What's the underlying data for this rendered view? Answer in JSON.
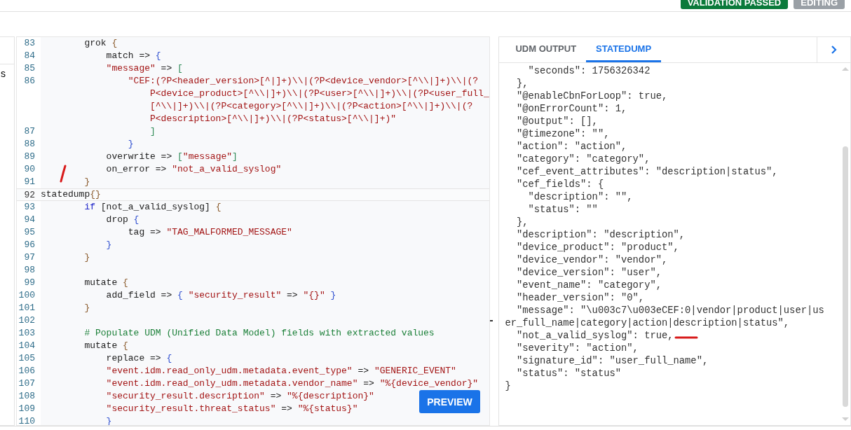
{
  "header": {
    "badges": [
      {
        "label": "VALIDATION PASSED",
        "kind": "success"
      },
      {
        "label": "EDITING",
        "kind": "neutral"
      }
    ]
  },
  "sidebar": {
    "text": "s"
  },
  "editor": {
    "rows": [
      {
        "number": "83",
        "current": false,
        "tokens": [
          {
            "kind": "plain",
            "text": "        grok "
          },
          {
            "kind": "brace1",
            "text": "{"
          }
        ]
      },
      {
        "number": "84",
        "current": false,
        "tokens": [
          {
            "kind": "plain",
            "text": "            match => "
          },
          {
            "kind": "brace2",
            "text": "{"
          }
        ]
      },
      {
        "number": "85",
        "current": false,
        "tokens": [
          {
            "kind": "string",
            "text": "            \"message\""
          },
          {
            "kind": "plain",
            "text": " => "
          },
          {
            "kind": "brace3",
            "text": "["
          }
        ]
      },
      {
        "number": "86",
        "current": false,
        "tokens": [
          {
            "kind": "string",
            "text": "                \"CEF:(?P<header_version>[^|]+)\\\\|(?P<device_vendor>[^\\\\|]+)\\\\|(?"
          }
        ]
      },
      {
        "current": false,
        "tokens": [
          {
            "kind": "string",
            "text": "                    P<device_product>[^\\\\|]+)\\\\|(?P<user>[^\\\\|]+)\\\\|(?P<user_full_"
          }
        ]
      },
      {
        "current": false,
        "tokens": [
          {
            "kind": "string",
            "text": "                    [^\\\\|]+)\\\\|(?P<category>[^\\\\|]+)\\\\|(?P<action>[^\\\\|]+)\\\\|(?"
          }
        ]
      },
      {
        "current": false,
        "tokens": [
          {
            "kind": "string",
            "text": "                    P<description>[^\\\\|]+)\\\\|(?P<status>[^\\\\|]+)\""
          }
        ]
      },
      {
        "number": "87",
        "current": false,
        "tokens": [
          {
            "kind": "brace3",
            "text": "                    ]"
          }
        ]
      },
      {
        "number": "88",
        "current": false,
        "tokens": [
          {
            "kind": "brace2",
            "text": "                }"
          }
        ]
      },
      {
        "number": "89",
        "current": false,
        "tokens": [
          {
            "kind": "plain",
            "text": "            overwrite => "
          },
          {
            "kind": "brace3",
            "text": "["
          },
          {
            "kind": "string",
            "text": "\"message\""
          },
          {
            "kind": "brace3",
            "text": "]"
          }
        ]
      },
      {
        "number": "90",
        "current": false,
        "tokens": [
          {
            "kind": "plain",
            "text": "            on_error => "
          },
          {
            "kind": "string",
            "text": "\"not_a_valid_syslog\""
          }
        ]
      },
      {
        "number": "91",
        "current": false,
        "tokens": [
          {
            "kind": "brace1",
            "text": "        }"
          }
        ]
      },
      {
        "number": "92",
        "current": true,
        "tokens": [
          {
            "kind": "plain",
            "text": "statedump"
          },
          {
            "kind": "brace1",
            "text": "{}"
          }
        ]
      },
      {
        "number": "93",
        "current": false,
        "tokens": [
          {
            "kind": "keyword",
            "text": "        if"
          },
          {
            "kind": "plain",
            "text": " [not_a_valid_syslog] "
          },
          {
            "kind": "brace1",
            "text": "{"
          }
        ]
      },
      {
        "number": "94",
        "current": false,
        "tokens": [
          {
            "kind": "plain",
            "text": "            drop "
          },
          {
            "kind": "brace2",
            "text": "{"
          }
        ]
      },
      {
        "number": "95",
        "current": false,
        "tokens": [
          {
            "kind": "plain",
            "text": "                tag => "
          },
          {
            "kind": "string",
            "text": "\"TAG_MALFORMED_MESSAGE\""
          }
        ]
      },
      {
        "number": "96",
        "current": false,
        "tokens": [
          {
            "kind": "brace2",
            "text": "            }"
          }
        ]
      },
      {
        "number": "97",
        "current": false,
        "tokens": [
          {
            "kind": "brace1",
            "text": "        }"
          }
        ]
      },
      {
        "number": "98",
        "current": false
      },
      {
        "number": "99",
        "current": false,
        "tokens": [
          {
            "kind": "plain",
            "text": "        mutate "
          },
          {
            "kind": "brace1",
            "text": "{"
          }
        ]
      },
      {
        "number": "100",
        "current": false,
        "tokens": [
          {
            "kind": "plain",
            "text": "            add_field => "
          },
          {
            "kind": "brace2",
            "text": "{"
          },
          {
            "kind": "string",
            "text": " \"security_result\""
          },
          {
            "kind": "plain",
            "text": " => "
          },
          {
            "kind": "string",
            "text": "\"{}\""
          },
          {
            "kind": "brace2",
            "text": " }"
          }
        ]
      },
      {
        "number": "101",
        "current": false,
        "tokens": [
          {
            "kind": "brace1",
            "text": "        }"
          }
        ]
      },
      {
        "number": "102",
        "current": false
      },
      {
        "number": "103",
        "current": false,
        "tokens": [
          {
            "kind": "comment",
            "text": "        # Populate UDM (Unified Data Model) fields with extracted values"
          }
        ]
      },
      {
        "number": "104",
        "current": false,
        "tokens": [
          {
            "kind": "plain",
            "text": "        mutate "
          },
          {
            "kind": "brace1",
            "text": "{"
          }
        ]
      },
      {
        "number": "105",
        "current": false,
        "tokens": [
          {
            "kind": "plain",
            "text": "            replace => "
          },
          {
            "kind": "brace2",
            "text": "{"
          }
        ]
      },
      {
        "number": "106",
        "current": false,
        "tokens": [
          {
            "kind": "string",
            "text": "            \"event.idm.read_only_udm.metadata.event_type\""
          },
          {
            "kind": "plain",
            "text": " => "
          },
          {
            "kind": "string",
            "text": "\"GENERIC_EVENT\""
          }
        ]
      },
      {
        "number": "107",
        "current": false,
        "tokens": [
          {
            "kind": "string",
            "text": "            \"event.idm.read_only_udm.metadata.vendor_name\""
          },
          {
            "kind": "plain",
            "text": " => "
          },
          {
            "kind": "string",
            "text": "\"%{device_vendor}\""
          }
        ]
      },
      {
        "number": "108",
        "current": false,
        "tokens": [
          {
            "kind": "string",
            "text": "            \"security_result.description\""
          },
          {
            "kind": "plain",
            "text": " => "
          },
          {
            "kind": "string",
            "text": "\"%{description}\""
          }
        ]
      },
      {
        "number": "109",
        "current": false,
        "tokens": [
          {
            "kind": "string",
            "text": "            \"security_result.threat_status\""
          },
          {
            "kind": "plain",
            "text": " => "
          },
          {
            "kind": "string",
            "text": "\"%{status}\""
          }
        ]
      },
      {
        "number": "110",
        "current": false,
        "tokens": [
          {
            "kind": "brace2",
            "text": "            }"
          }
        ]
      }
    ]
  },
  "preview_button": "PREVIEW",
  "output_panel": {
    "tabs": [
      {
        "label": "UDM OUTPUT",
        "selected": false
      },
      {
        "label": "STATEDUMP",
        "selected": true
      }
    ],
    "lines": [
      "    \"seconds\": 1756326342",
      "  },",
      "  \"@enableCbnForLoop\": true,",
      "  \"@onErrorCount\": 1,",
      "  \"@output\": [],",
      "  \"@timezone\": \"\",",
      "  \"action\": \"action\",",
      "  \"category\": \"category\",",
      "  \"cef_event_attributes\": \"description|status\",",
      "  \"cef_fields\": {",
      "    \"description\": \"\",",
      "    \"status\": \"\"",
      "  },",
      "  \"description\": \"description\",",
      "  \"device_product\": \"product\",",
      "  \"device_vendor\": \"vendor\",",
      "  \"device_version\": \"user\",",
      "  \"event_name\": \"category\",",
      "  \"header_version\": \"0\",",
      "  \"message\": \"\\u003c7\\u003eCEF:0|vendor|product|user|user_full_name|category|action|description|status\",",
      "  \"not_a_valid_syslog\": true,",
      "  \"severity\": \"action\",",
      "  \"signature_id\": \"user_full_name\",",
      "  \"status\": \"status\"",
      "}"
    ]
  }
}
